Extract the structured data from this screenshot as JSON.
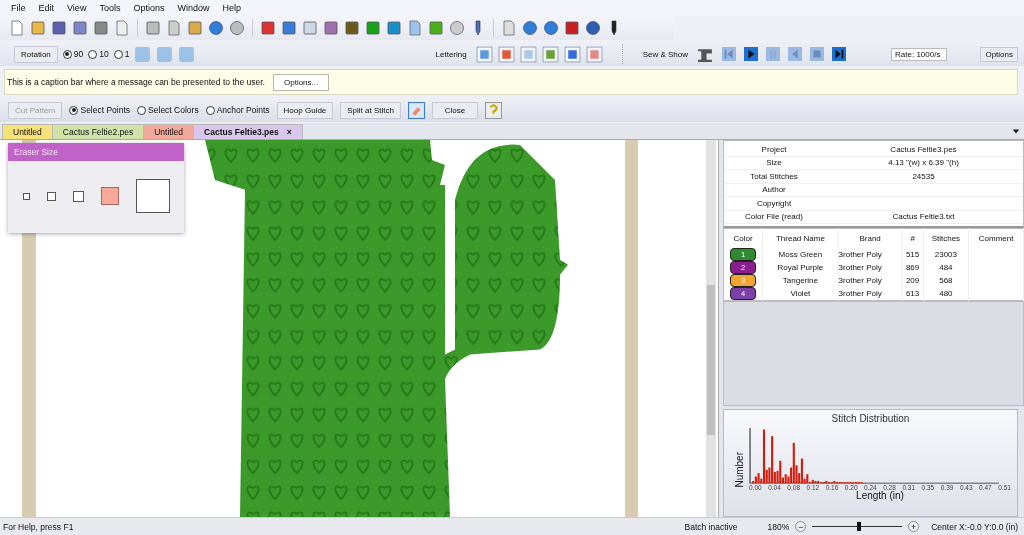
{
  "menu": [
    "File",
    "Edit",
    "View",
    "Tools",
    "Options",
    "Window",
    "Help"
  ],
  "rotation": {
    "button": "Rotation",
    "options": [
      {
        "label": "90",
        "selected": true
      },
      {
        "label": "10",
        "selected": false
      },
      {
        "label": "1",
        "selected": false
      }
    ]
  },
  "lettering": {
    "label": "Lettering"
  },
  "sew_show": {
    "label": "Sew & Show",
    "rate": "Rate: 1000/s",
    "options": "Options"
  },
  "caption_bar": {
    "message": "This is a caption bar where a message can be presented to the user.",
    "button": "Options..."
  },
  "edit_bar": {
    "cut_pattern": {
      "label": "Cut Pattern",
      "disabled": true
    },
    "modes": [
      {
        "label": "Select Points",
        "selected": true
      },
      {
        "label": "Select Colors",
        "selected": false
      },
      {
        "label": "Anchor Points",
        "selected": false
      }
    ],
    "hoop_guide": "Hoop Guide",
    "split": "Split at Stitch",
    "close": "Close"
  },
  "tabs": [
    {
      "label": "Untitled",
      "color": "#f7e27a",
      "selected": false
    },
    {
      "label": "Cactus Feltie2.pes",
      "color": "#cfe3a8",
      "selected": false
    },
    {
      "label": "Untitled",
      "color": "#f2a99a",
      "selected": false
    },
    {
      "label": "Cactus Feltie3.pes",
      "color": "#d9c6ec",
      "selected": true,
      "close": "×"
    }
  ],
  "eraser": {
    "title": "Eraser Size",
    "sizes": [
      {
        "selected": false
      },
      {
        "selected": false
      },
      {
        "selected": false
      },
      {
        "selected": true
      },
      {
        "selected": false
      }
    ]
  },
  "properties": [
    {
      "label": "Project",
      "value": "Cactus Feltie3.pes"
    },
    {
      "label": "Size",
      "value": "4.13 \"(w) x 6.39 \"(h)"
    },
    {
      "label": "Total Stitches",
      "value": "24535"
    },
    {
      "label": "Author"
    },
    {
      "label": "Copyright"
    },
    {
      "label": "Color File (read)",
      "value": "Cactus Feltie3.txt"
    }
  ],
  "threads": {
    "columns": [
      "Color",
      "Thread Name",
      "Brand",
      "#",
      "Stitches",
      "Comment"
    ],
    "rows": [
      {
        "number": "1",
        "color": "#2e8b2e",
        "name": "Moss Green",
        "brand": "3rother Poly",
        "code": "515",
        "stitches": "23003"
      },
      {
        "number": "2",
        "color": "#8b1f8f",
        "name": "Royal Purple",
        "brand": "3rother Poly",
        "code": "869",
        "stitches": "484"
      },
      {
        "number": "3",
        "color": "#f4a430",
        "name": "Tangerine",
        "brand": "3rother Poly",
        "code": "209",
        "stitches": "568"
      },
      {
        "number": "4",
        "color": "#7b3fa8",
        "name": "Violet",
        "brand": "3rother Poly",
        "code": "613",
        "stitches": "480"
      }
    ]
  },
  "distribution": {
    "title": "Stitch Distribution",
    "ylabel": "Number",
    "xlabel": "Length (in)",
    "xticks": [
      "0.00",
      "0.04",
      "0.08",
      "0.12",
      "0.16",
      "0.20",
      "0.24",
      "0.28",
      "0.31",
      "0.35",
      "0.39",
      "0.43",
      "0.47",
      "0.51"
    ]
  },
  "status_bar": {
    "help": "For Help, press F1",
    "batch": "Batch inactive",
    "zoom": "180%",
    "zoom_minus": "−",
    "zoom_plus": "+",
    "zoom_slider": {
      "level": 0.5
    },
    "center": "Center X:-0.0  Y:0.0 (in)"
  }
}
